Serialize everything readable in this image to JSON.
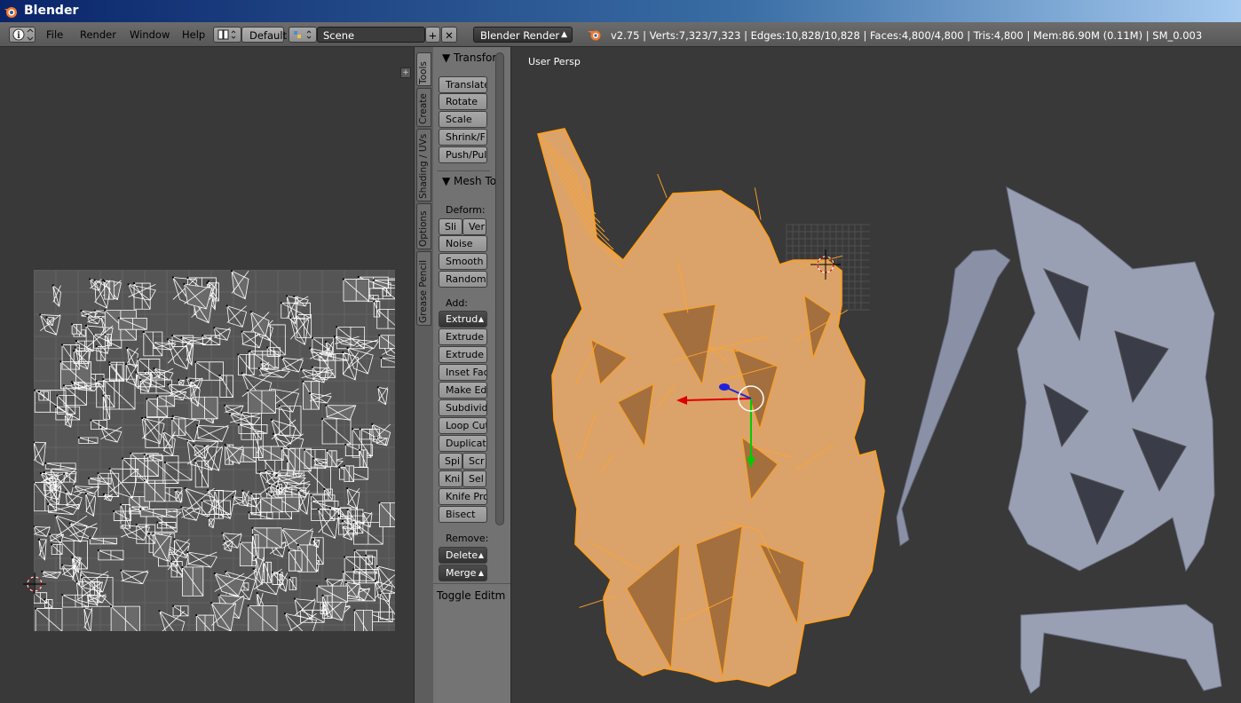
{
  "window": {
    "title": "Blender"
  },
  "infobar": {
    "menus": [
      "File",
      "Render",
      "Window",
      "Help"
    ],
    "screen_layout": "Default",
    "scene": "Scene",
    "render_engine": "Blender Render",
    "stats": "v2.75 | Verts:7,323/7,323 | Edges:10,828/10,828 | Faces:4,800/4,800 | Tris:4,800 | Mem:86.90M (0.11M) | SM_0.003"
  },
  "tool_tabs": [
    "Tools",
    "Create",
    "Shading / UVs",
    "Options",
    "Grease Pencil"
  ],
  "toolshelf": {
    "transform": {
      "title": "Transfor",
      "buttons": [
        "Translate",
        "Rotate",
        "Scale",
        "Shrink/F",
        "Push/Pull"
      ]
    },
    "mesh_tools": {
      "title": "Mesh To",
      "deform_label": "Deform:",
      "deform_row": [
        "Sli",
        "Ver"
      ],
      "deform_buttons": [
        "Noise",
        "Smooth",
        "Randomi"
      ],
      "add_label": "Add:",
      "add_dropdown": "Extrud",
      "add_buttons": [
        "Extrude",
        "Extrude I",
        "Inset Fac",
        "Make Ed",
        "Subdivid",
        "Loop Cut",
        "Duplicat"
      ],
      "add_row1": [
        "Spi",
        "Scr"
      ],
      "add_row2": [
        "Kni",
        "Sel"
      ],
      "add_buttons2": [
        "Knife Pro",
        "Bisect"
      ],
      "remove_label": "Remove:",
      "remove_dropdowns": [
        "Delete",
        "Merge"
      ]
    },
    "toggle_editmode": "Toggle Editmo"
  },
  "viewport": {
    "label": "User Persp"
  },
  "colors": {
    "accent_selected": "#ff9f1c",
    "mesh_fill": "#e0a96d",
    "object_unselected": "#9aa0b4"
  }
}
